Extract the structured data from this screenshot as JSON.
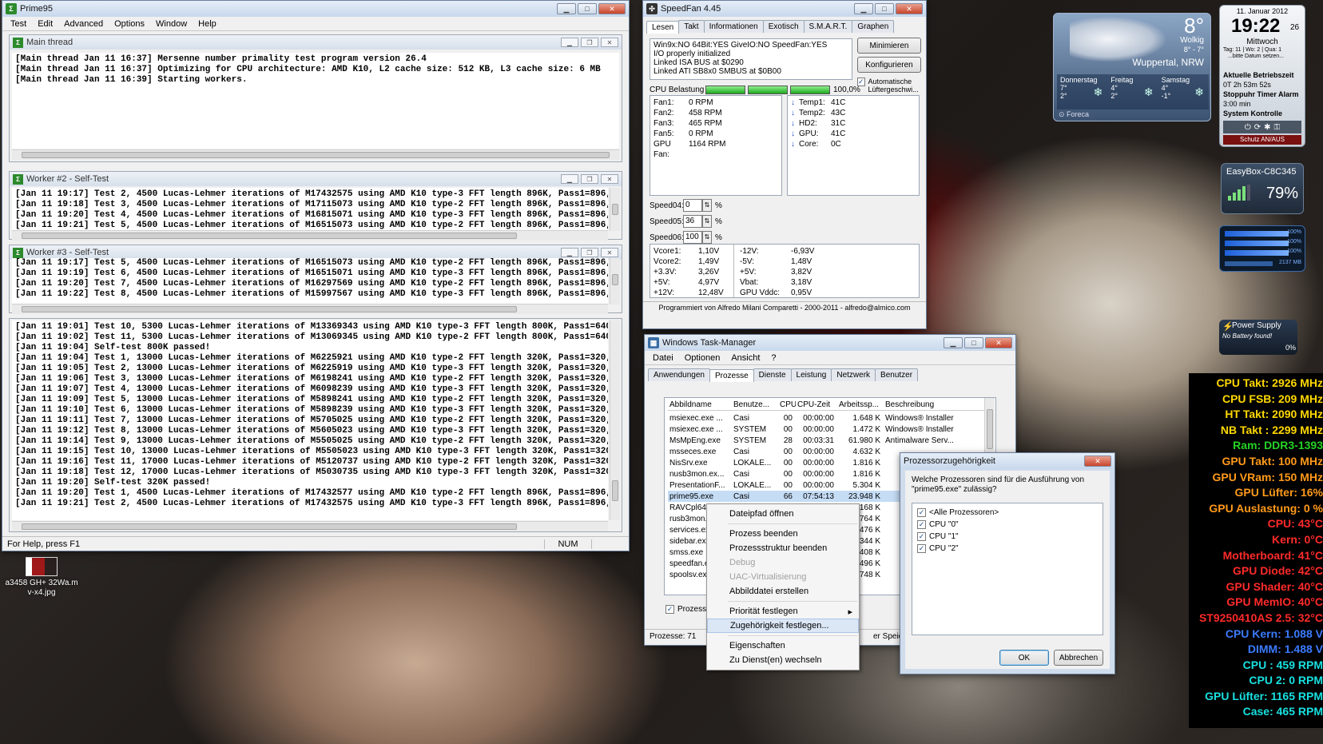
{
  "prime95": {
    "title": "Prime95",
    "menu": [
      "Test",
      "Edit",
      "Advanced",
      "Options",
      "Window",
      "Help"
    ],
    "main_thread": {
      "title": "Main thread",
      "lines": [
        "[Main thread Jan 11 16:37] Mersenne number primality test program version 26.4",
        "[Main thread Jan 11 16:37] Optimizing for CPU architecture: AMD K10, L2 cache size: 512 KB, L3 cache size: 6 MB",
        "[Main thread Jan 11 16:39] Starting workers."
      ]
    },
    "worker2": {
      "title": "Worker #2 - Self-Test",
      "lines": [
        "[Jan 11 19:17] Test 2, 4500 Lucas-Lehmer iterations of M17432575 using AMD K10 type-3 FFT length 896K, Pass1=896, Pass2=1K.",
        "[Jan 11 19:18] Test 3, 4500 Lucas-Lehmer iterations of M17115073 using AMD K10 type-2 FFT length 896K, Pass1=896, Pass2=1K.",
        "[Jan 11 19:20] Test 4, 4500 Lucas-Lehmer iterations of M16815071 using AMD K10 type-3 FFT length 896K, Pass1=896, Pass2=1K.",
        "[Jan 11 19:21] Test 5, 4500 Lucas-Lehmer iterations of M16515073 using AMD K10 type-2 FFT length 896K, Pass1=896, Pass2=1K."
      ]
    },
    "worker3": {
      "title": "Worker #3 - Self-Test",
      "lines": [
        "[Jan 11 19:17] Test 5, 4500 Lucas-Lehmer iterations of M16515073 using AMD K10 type-2 FFT length 896K, Pass1=896, Pass2=1K.",
        "[Jan 11 19:19] Test 6, 4500 Lucas-Lehmer iterations of M16515071 using AMD K10 type-3 FFT length 896K, Pass1=896, Pass2=1K.",
        "[Jan 11 19:20] Test 7, 4500 Lucas-Lehmer iterations of M16297569 using AMD K10 type-2 FFT length 896K, Pass1=896, Pass2=1K.",
        "[Jan 11 19:22] Test 8, 4500 Lucas-Lehmer iterations of M15997567 using AMD K10 type-3 FFT length 896K, Pass1=896, Pass2=1K."
      ]
    },
    "worker1_lines": [
      "[Jan 11 19:01] Test 10, 5300 Lucas-Lehmer iterations of M13369343 using AMD K10 type-3 FFT length 800K, Pass1=640, Pass2=1280",
      "[Jan 11 19:02] Test 11, 5300 Lucas-Lehmer iterations of M13069345 using AMD K10 type-2 FFT length 800K, Pass1=640, Pass2=1280",
      "[Jan 11 19:04] Self-test 800K passed!",
      "[Jan 11 19:04] Test 1, 13000 Lucas-Lehmer iterations of M6225921 using AMD K10 type-2 FFT length 320K, Pass1=320, Pass2=1K.",
      "[Jan 11 19:05] Test 2, 13000 Lucas-Lehmer iterations of M6225919 using AMD K10 type-3 FFT length 320K, Pass1=320, Pass2=1K.",
      "[Jan 11 19:06] Test 3, 13000 Lucas-Lehmer iterations of M6198241 using AMD K10 type-2 FFT length 320K, Pass1=320, Pass2=1K.",
      "[Jan 11 19:07] Test 4, 13000 Lucas-Lehmer iterations of M6098239 using AMD K10 type-3 FFT length 320K, Pass1=320, Pass2=1K.",
      "[Jan 11 19:09] Test 5, 13000 Lucas-Lehmer iterations of M5898241 using AMD K10 type-2 FFT length 320K, Pass1=320, Pass2=1K.",
      "[Jan 11 19:10] Test 6, 13000 Lucas-Lehmer iterations of M5898239 using AMD K10 type-3 FFT length 320K, Pass1=320, Pass2=1K.",
      "[Jan 11 19:11] Test 7, 13000 Lucas-Lehmer iterations of M5705025 using AMD K10 type-2 FFT length 320K, Pass1=320, Pass2=1K.",
      "[Jan 11 19:12] Test 8, 13000 Lucas-Lehmer iterations of M5605023 using AMD K10 type-3 FFT length 320K, Pass1=320, Pass2=1K.",
      "[Jan 11 19:14] Test 9, 13000 Lucas-Lehmer iterations of M5505025 using AMD K10 type-2 FFT length 320K, Pass1=320, Pass2=1K.",
      "[Jan 11 19:15] Test 10, 13000 Lucas-Lehmer iterations of M5505023 using AMD K10 type-3 FFT length 320K, Pass1=320, Pass2=1K.",
      "[Jan 11 19:16] Test 11, 17000 Lucas-Lehmer iterations of M5120737 using AMD K10 type-2 FFT length 320K, Pass1=320, Pass2=1K.",
      "[Jan 11 19:18] Test 12, 17000 Lucas-Lehmer iterations of M5030735 using AMD K10 type-3 FFT length 320K, Pass1=320, Pass2=1K.",
      "[Jan 11 19:20] Self-test 320K passed!",
      "[Jan 11 19:20] Test 1, 4500 Lucas-Lehmer iterations of M17432577 using AMD K10 type-2 FFT length 896K, Pass1=896, Pass2=1K.",
      "[Jan 11 19:21] Test 2, 4500 Lucas-Lehmer iterations of M17432575 using AMD K10 type-3 FFT length 896K, Pass1=896, Pass2=1K."
    ],
    "status_left": "For Help, press F1",
    "status_num": "NUM"
  },
  "desktop_icon": {
    "label": "a3458 GH+ 32Wa.m v-x4.jpg"
  },
  "speedfan": {
    "title": "SpeedFan 4.45",
    "tabs": [
      "Lesen",
      "Takt",
      "Informationen",
      "Exotisch",
      "S.M.A.R.T.",
      "Graphen"
    ],
    "log": [
      "Win9x:NO  64Bit:YES  GiveIO:NO  SpeedFan:YES",
      "I/O properly initialized",
      "Linked ISA BUS at $0290",
      "Linked ATI SB8x0 SMBUS at $0B00"
    ],
    "btn_minimize": "Minimieren",
    "btn_configure": "Konfigurieren",
    "cpu_load_label": "CPU Belastung",
    "cpu_load": "100,0%",
    "auto_fan": "Automatische Lüftergeschwi...",
    "fans": [
      [
        "Fan1:",
        "0 RPM"
      ],
      [
        "Fan2:",
        "458 RPM"
      ],
      [
        "Fan3:",
        "465 RPM"
      ],
      [
        "Fan5:",
        "0 RPM"
      ],
      [
        "GPU Fan:",
        "1164 RPM"
      ]
    ],
    "temps": [
      [
        "Temp1:",
        "41C"
      ],
      [
        "Temp2:",
        "43C"
      ],
      [
        "HD2:",
        "31C"
      ],
      [
        "GPU:",
        "41C"
      ],
      [
        "Core:",
        "0C"
      ]
    ],
    "speeds": [
      [
        "Speed04:",
        "0"
      ],
      [
        "Speed05:",
        "36"
      ],
      [
        "Speed06:",
        "100"
      ]
    ],
    "pct": "%",
    "volts_left": [
      [
        "Vcore1:",
        "1,10V"
      ],
      [
        "Vcore2:",
        "1,49V"
      ],
      [
        "+3.3V:",
        "3,26V"
      ],
      [
        "+5V:",
        "4,97V"
      ],
      [
        "+12V:",
        "12,48V"
      ]
    ],
    "volts_right": [
      [
        "-12V:",
        "-6,93V"
      ],
      [
        "-5V:",
        "1,48V"
      ],
      [
        "+5V:",
        "3,82V"
      ],
      [
        "Vbat:",
        "3,18V"
      ],
      [
        "GPU Vddc:",
        "0,95V"
      ]
    ],
    "footer": "Programmiert von Alfredo Milani Comparetti - 2000-2011 - alfredo@almico.com"
  },
  "taskmgr": {
    "title": "Windows Task-Manager",
    "menu": [
      "Datei",
      "Optionen",
      "Ansicht",
      "?"
    ],
    "tabs": [
      "Anwendungen",
      "Prozesse",
      "Dienste",
      "Leistung",
      "Netzwerk",
      "Benutzer"
    ],
    "columns": [
      "Abbildname",
      "Benutze...",
      "CPU",
      "CPU-Zeit",
      "Arbeitssp...",
      "Beschreibung"
    ],
    "rows": [
      [
        "msiexec.exe ...",
        "Casi",
        "00",
        "00:00:00",
        "1.648 K",
        "Windows® Installer"
      ],
      [
        "msiexec.exe ...",
        "SYSTEM",
        "00",
        "00:00:00",
        "1.472 K",
        "Windows® Installer"
      ],
      [
        "MsMpEng.exe",
        "SYSTEM",
        "28",
        "00:03:31",
        "61.980 K",
        "Antimalware Serv..."
      ],
      [
        "msseces.exe",
        "Casi",
        "00",
        "00:00:00",
        "4.632 K",
        ""
      ],
      [
        "NisSrv.exe",
        "LOKALE...",
        "00",
        "00:00:00",
        "1.816 K",
        ""
      ],
      [
        "nusb3mon.ex...",
        "Casi",
        "00",
        "00:00:00",
        "1.816 K",
        ""
      ],
      [
        "PresentationF...",
        "LOKALE...",
        "00",
        "00:00:00",
        "5.304 K",
        ""
      ],
      [
        "prime95.exe",
        "Casi",
        "66",
        "07:54:13",
        "23.948 K",
        ""
      ],
      [
        "RAVCpl64....",
        "",
        "",
        "",
        "4.168 K",
        ""
      ],
      [
        "rusb3mon....",
        "",
        "",
        "",
        "1.764 K",
        ""
      ],
      [
        "services.ex...",
        "",
        "",
        "",
        "6.476 K",
        ""
      ],
      [
        "sidebar.ex...",
        "",
        "",
        "",
        "8.344 K",
        ""
      ],
      [
        "smss.exe",
        "",
        "",
        "",
        "408 K",
        ""
      ],
      [
        "speedfan.e...",
        "",
        "",
        "",
        "5.496 K",
        ""
      ],
      [
        "spoolsv.ex...",
        "",
        "",
        "",
        "4.748 K",
        ""
      ]
    ],
    "show_all": "Prozesse",
    "status_procs": "Prozesse: 71",
    "status_mem": "er Speiche"
  },
  "context_menu": {
    "items": [
      {
        "label": "Dateipfad öffnen",
        "state": "normal"
      },
      {
        "sep": true
      },
      {
        "label": "Prozess beenden",
        "state": "normal"
      },
      {
        "label": "Prozessstruktur beenden",
        "state": "normal"
      },
      {
        "label": "Debug",
        "state": "disabled"
      },
      {
        "label": "UAC-Virtualisierung",
        "state": "disabled"
      },
      {
        "label": "Abbilddatei erstellen",
        "state": "normal"
      },
      {
        "sep": true
      },
      {
        "label": "Priorität festlegen",
        "state": "submenu"
      },
      {
        "label": "Zugehörigkeit festlegen...",
        "state": "highlight"
      },
      {
        "sep": true
      },
      {
        "label": "Eigenschaften",
        "state": "normal"
      },
      {
        "label": "Zu Dienst(en) wechseln",
        "state": "normal"
      }
    ]
  },
  "affinity": {
    "title": "Prozessorzugehörigkeit",
    "question": "Welche Prozessoren sind für die Ausführung von \"prime95.exe\" zulässig?",
    "items": [
      "<Alle Prozessoren>",
      "CPU \"0\"",
      "CPU \"1\"",
      "CPU \"2\""
    ],
    "ok": "OK",
    "cancel": "Abbrechen"
  },
  "weather": {
    "temp": "8°",
    "cond": "Wolkig",
    "range": "8° - 7°",
    "city": "Wuppertal, NRW",
    "days": [
      [
        "Donnerstag",
        "7°",
        "2°"
      ],
      [
        "Freitag",
        "4°",
        "2°"
      ],
      [
        "Samstag",
        "4°",
        "-1°"
      ]
    ],
    "source": "Foreca"
  },
  "clock": {
    "date": "11. Januar 2012",
    "time": "19:22",
    "sec": "26",
    "day": "Mittwoch",
    "line1": "Tag: 11 | Wo: 2 | Qua: 1",
    "line2": "...bitte Datum setzen...",
    "uptime_label": "Aktuelle Betriebszeit",
    "uptime": "0T 2h 53m 52s",
    "timer_label": "Stoppuhr Timer Alarm",
    "timer": "3:00 min",
    "sys_label": "System Kontrolle",
    "protect": "Schutz AN/AUS"
  },
  "wifi": {
    "name": "EasyBox-C8C345",
    "pct": "79%"
  },
  "meter": {
    "val1": "100%",
    "val2": "100%",
    "val3": "100%",
    "val4": "2137 MB"
  },
  "power": {
    "title": "Power Supply",
    "sub": "No Battery found!",
    "pct": "0%"
  },
  "hwinfo": [
    {
      "t": "CPU Takt: 2926 MHz",
      "c": "#ffd800"
    },
    {
      "t": "CPU FSB: 209 MHz",
      "c": "#ffd800"
    },
    {
      "t": "HT Takt: 2090 MHz",
      "c": "#ffd800"
    },
    {
      "t": "NB Takt : 2299 MHz",
      "c": "#ffd800"
    },
    {
      "t": "Ram: DDR3-1393",
      "c": "#25d425"
    },
    {
      "t": "GPU Takt: 100 MHz",
      "c": "#ff9a1a"
    },
    {
      "t": "GPU VRam: 150 MHz",
      "c": "#ff9a1a"
    },
    {
      "t": "GPU Lüfter: 16%",
      "c": "#ff9a1a"
    },
    {
      "t": "GPU Auslastung: 0 %",
      "c": "#ff9a1a"
    },
    {
      "t": "CPU: 43°C",
      "c": "#ff2a2a"
    },
    {
      "t": "Kern: 0°C",
      "c": "#ff2a2a"
    },
    {
      "t": "Motherboard: 41°C",
      "c": "#ff2a2a"
    },
    {
      "t": "GPU Diode: 42°C",
      "c": "#ff2a2a"
    },
    {
      "t": "GPU Shader: 40°C",
      "c": "#ff2a2a"
    },
    {
      "t": "GPU MemIO: 40°C",
      "c": "#ff2a2a"
    },
    {
      "t": "ST9250410AS 2.5: 32°C",
      "c": "#ff2a2a"
    },
    {
      "t": "CPU Kern: 1.088 V",
      "c": "#3b7bff"
    },
    {
      "t": "DIMM: 1.488 V",
      "c": "#3b7bff"
    },
    {
      "t": "CPU : 459 RPM",
      "c": "#19e0e0"
    },
    {
      "t": "CPU 2: 0 RPM",
      "c": "#19e0e0"
    },
    {
      "t": "GPU Lüfter: 1165 RPM",
      "c": "#19e0e0"
    },
    {
      "t": "Case: 465 RPM",
      "c": "#19e0e0"
    }
  ]
}
